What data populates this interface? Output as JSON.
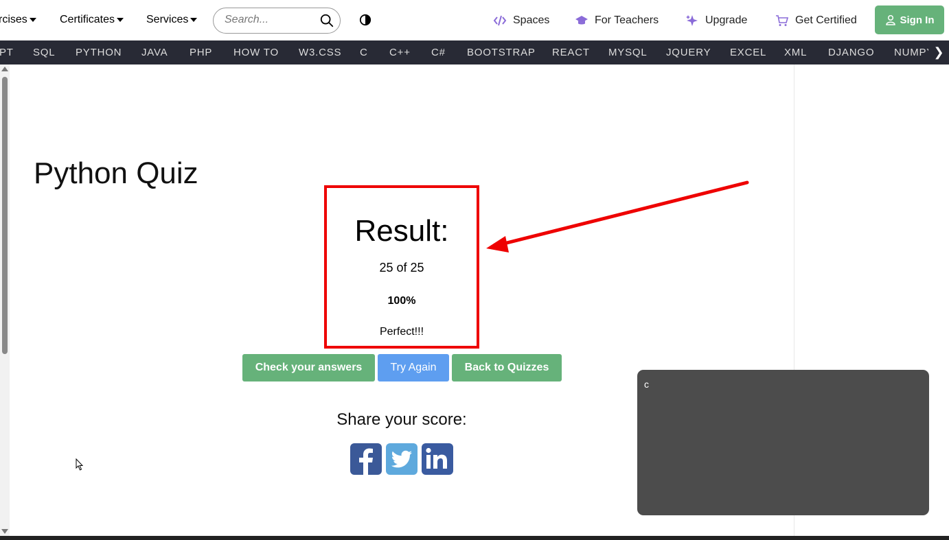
{
  "nav": {
    "exercises": "rcises",
    "certificates": "Certificates",
    "services": "Services",
    "search_placeholder": "Search...",
    "links": {
      "spaces": "Spaces",
      "teachers": "For Teachers",
      "upgrade": "Upgrade",
      "certified": "Get Certified"
    },
    "signin": "Sign In"
  },
  "subjects": [
    "PT",
    "SQL",
    "PYTHON",
    "JAVA",
    "PHP",
    "HOW TO",
    "W3.CSS",
    "C",
    "C++",
    "C#",
    "BOOTSTRAP",
    "REACT",
    "MYSQL",
    "JQUERY",
    "EXCEL",
    "XML",
    "DJANGO",
    "NUMPY"
  ],
  "main": {
    "title": "Python Quiz",
    "result": {
      "title": "Result:",
      "score": "25 of 25",
      "percent": "100%",
      "message": "Perfect!!!"
    },
    "buttons": {
      "check": "Check your answers",
      "try_again": "Try Again",
      "back": "Back to Quizzes"
    },
    "share_heading": "Share your score:"
  },
  "overlay": {
    "text": "c"
  },
  "colors": {
    "accent_green": "#66b27a",
    "try_again_blue": "#5e9ef0",
    "subject_bar": "#282a35",
    "annotation_red": "#ee0000"
  },
  "icons": [
    "search-icon",
    "contrast-icon",
    "code-icon",
    "graduation-cap-icon",
    "sparkle-icon",
    "cart-icon",
    "user-icon",
    "facebook-icon",
    "twitter-icon",
    "linkedin-icon"
  ]
}
